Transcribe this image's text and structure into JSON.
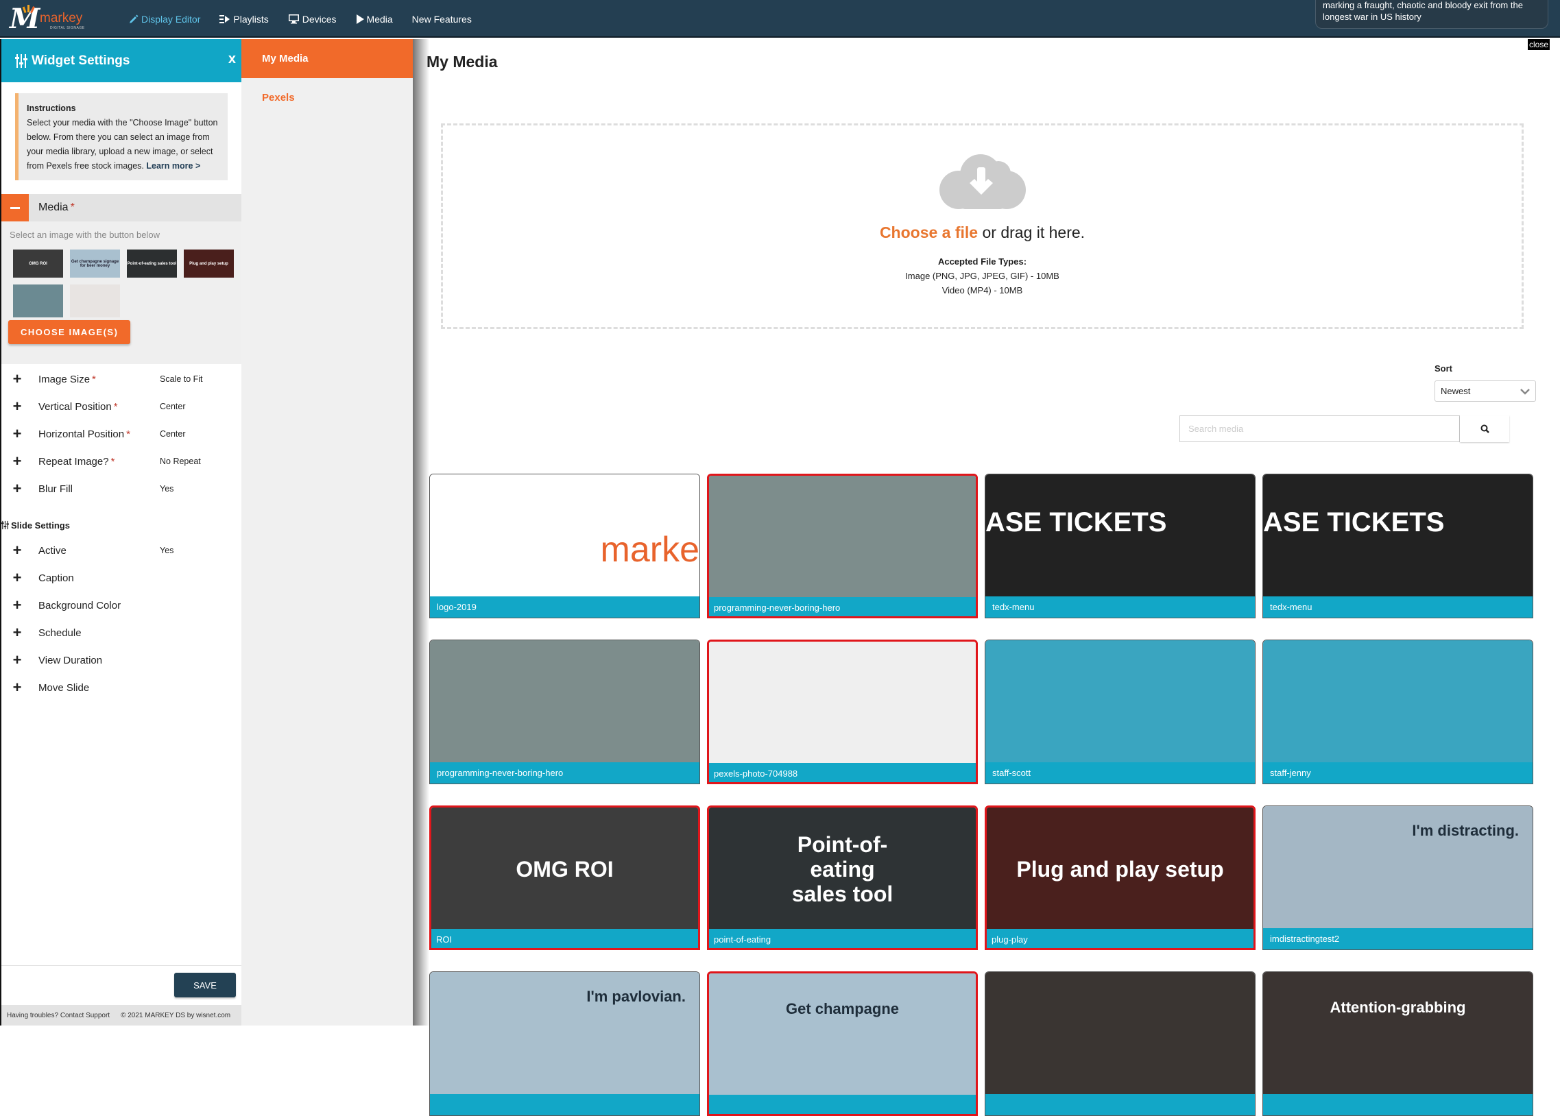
{
  "nav": {
    "logo_text": "markey",
    "logo_sub": "DIGITAL SIGNAGE",
    "items": [
      {
        "label": "Display Editor",
        "icon": "pencil-icon",
        "active": true
      },
      {
        "label": "Playlists",
        "icon": "playlist-icon",
        "active": false
      },
      {
        "label": "Devices",
        "icon": "monitor-icon",
        "active": false
      },
      {
        "label": "Media",
        "icon": "play-icon",
        "active": false
      },
      {
        "label": "New Features",
        "icon": null,
        "active": false
      }
    ]
  },
  "notification": {
    "text": "marking a fraught, chaotic and bloody exit from the longest war in US history"
  },
  "close_tag": "close",
  "widget_settings": {
    "title": "Widget Settings",
    "close_label": "x",
    "instructions": {
      "heading": "Instructions",
      "body": "Select your media with the \"Choose Image\" button below. From there you can select an image from your media library, upload a new image, or select from Pexels free stock images.",
      "link": "Learn more >"
    },
    "media_section": {
      "label": "Media",
      "required": "*",
      "hint": "Select an image with the button below",
      "thumbnails": [
        {
          "name": "OMG ROI",
          "bg": "#3a3a3a"
        },
        {
          "name": "Get champagne signage for beer money",
          "bg": "#a9c0cf"
        },
        {
          "name": "Point-of-eating sales tool",
          "bg": "#2c2f30"
        },
        {
          "name": "Plug and play setup",
          "bg": "#4a1f1c"
        },
        {
          "name": "",
          "bg": "#6b8a92"
        },
        {
          "name": "",
          "bg": "#e8e4e2"
        }
      ],
      "choose_button": "CHOOSE IMAGE(S)"
    },
    "settings": [
      {
        "label": "Image Size",
        "required": true,
        "value": "Scale to Fit"
      },
      {
        "label": "Vertical Position",
        "required": true,
        "value": "Center"
      },
      {
        "label": "Horizontal Position",
        "required": true,
        "value": "Center"
      },
      {
        "label": "Repeat Image?",
        "required": true,
        "value": "No Repeat"
      },
      {
        "label": "Blur Fill",
        "required": false,
        "value": "Yes"
      }
    ],
    "slide_settings_title": "Slide Settings",
    "slide_settings": [
      {
        "label": "Active",
        "value": "Yes"
      },
      {
        "label": "Caption",
        "value": ""
      },
      {
        "label": "Background Color",
        "value": ""
      },
      {
        "label": "Schedule",
        "value": ""
      },
      {
        "label": "View Duration",
        "value": ""
      },
      {
        "label": "Move Slide",
        "value": ""
      }
    ],
    "save_label": "SAVE",
    "footer_support": "Having troubles? Contact Support",
    "footer_copyright": "© 2021 MARKEY DS by wisnet.com"
  },
  "sources": {
    "tabs": [
      {
        "label": "My Media",
        "active": true
      },
      {
        "label": "Pexels",
        "active": false
      }
    ]
  },
  "main": {
    "title": "My Media",
    "dropzone": {
      "choose": "Choose a file",
      "rest": " or drag it here.",
      "types_heading": "Accepted File Types:",
      "types_image": "Image (PNG, JPG, JPEG, GIF) - 10MB",
      "types_video": "Video (MP4) - 10MB"
    },
    "sort_label": "Sort",
    "sort_value": "Newest",
    "search_placeholder": "Search media",
    "search_value": "",
    "media": [
      {
        "caption": "logo-2019",
        "selected": false,
        "bg": "#ffffff",
        "overlay": "marke",
        "overlay_color": "#e8632c"
      },
      {
        "caption": "programming-never-boring-hero",
        "selected": true,
        "bg": "#7d8d8c",
        "overlay": "",
        "overlay_color": "#fff"
      },
      {
        "caption": "tedx-menu",
        "selected": false,
        "bg": "#222222",
        "overlay": "ASE TICKETS",
        "overlay_color": "#fff"
      },
      {
        "caption": "tedx-menu",
        "selected": false,
        "bg": "#222222",
        "overlay": "ASE TICKETS",
        "overlay_color": "#fff"
      },
      {
        "caption": "programming-never-boring-hero",
        "selected": false,
        "bg": "#7d8d8c",
        "overlay": "",
        "overlay_color": "#fff"
      },
      {
        "caption": "pexels-photo-704988",
        "selected": true,
        "bg": "#efefef",
        "overlay": "",
        "overlay_color": "#fff"
      },
      {
        "caption": "staff-scott",
        "selected": false,
        "bg": "#3aa5c0",
        "overlay": "",
        "overlay_color": "#fff"
      },
      {
        "caption": "staff-jenny",
        "selected": false,
        "bg": "#3aa5c0",
        "overlay": "",
        "overlay_color": "#fff"
      },
      {
        "caption": "ROI",
        "selected": true,
        "bg": "#3d3d3d",
        "overlay": "OMG ROI",
        "overlay_color": "#fff"
      },
      {
        "caption": "point-of-eating",
        "selected": true,
        "bg": "#2e3335",
        "overlay": "Point-of-eating sales tool",
        "overlay_color": "#fff"
      },
      {
        "caption": "plug-play",
        "selected": true,
        "bg": "#4a201d",
        "overlay": "Plug and play setup",
        "overlay_color": "#fff"
      },
      {
        "caption": "imdistractingtest2",
        "selected": false,
        "bg": "#a4b7c5",
        "overlay": "I'm distracting.",
        "overlay_color": "#1e2d3a"
      },
      {
        "caption": "",
        "selected": false,
        "bg": "#a9bfcd",
        "overlay": "I'm pavlovian.",
        "overlay_color": "#1e2d3a"
      },
      {
        "caption": "",
        "selected": true,
        "bg": "#a9c0cf",
        "overlay": "Get champagne",
        "overlay_color": "#1e2d3a"
      },
      {
        "caption": "",
        "selected": false,
        "bg": "#3a3532",
        "overlay": "",
        "overlay_color": "#fff"
      },
      {
        "caption": "",
        "selected": false,
        "bg": "#3b3432",
        "overlay": "Attention-grabbing",
        "overlay_color": "#fff"
      }
    ]
  },
  "colors": {
    "nav_bg": "#243f52",
    "accent_teal": "#11a6c6",
    "accent_orange": "#f16a2a",
    "selected_border": "#e0161b",
    "save_bg": "#234154"
  }
}
